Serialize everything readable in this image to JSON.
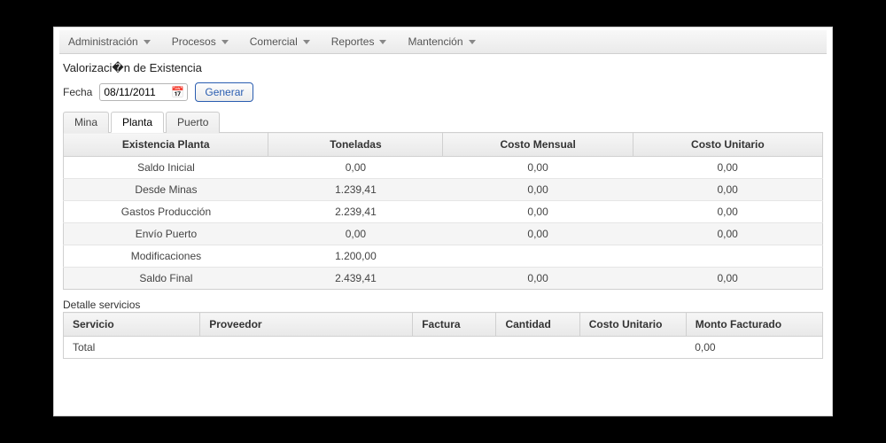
{
  "menubar": {
    "items": [
      "Administración",
      "Procesos",
      "Comercial",
      "Reportes",
      "Mantención"
    ]
  },
  "page": {
    "title": "Valorizaci�n de Existencia"
  },
  "filter": {
    "date_label": "Fecha",
    "date_value": "08/11/2011",
    "generate_label": "Generar"
  },
  "tabs": {
    "items": [
      "Mina",
      "Planta",
      "Puerto"
    ],
    "active_index": 1
  },
  "stock_table": {
    "headers": [
      "Existencia Planta",
      "Toneladas",
      "Costo Mensual",
      "Costo Unitario"
    ],
    "rows": [
      {
        "label": "Saldo Inicial",
        "ton": "0,00",
        "cm": "0,00",
        "cu": "0,00"
      },
      {
        "label": "Desde Minas",
        "ton": "1.239,41",
        "cm": "0,00",
        "cu": "0,00"
      },
      {
        "label": "Gastos Producción",
        "ton": "2.239,41",
        "cm": "0,00",
        "cu": "0,00"
      },
      {
        "label": "Envío Puerto",
        "ton": "0,00",
        "cm": "0,00",
        "cu": "0,00"
      },
      {
        "label": "Modificaciones",
        "ton": "1.200,00",
        "cm": "",
        "cu": ""
      },
      {
        "label": "Saldo Final",
        "ton": "2.439,41",
        "cm": "0,00",
        "cu": "0,00"
      }
    ]
  },
  "detail": {
    "section_label": "Detalle servicios",
    "headers": [
      "Servicio",
      "Proveedor",
      "Factura",
      "Cantidad",
      "Costo Unitario",
      "Monto Facturado"
    ],
    "total_label": "Total",
    "total_value": "0,00"
  }
}
